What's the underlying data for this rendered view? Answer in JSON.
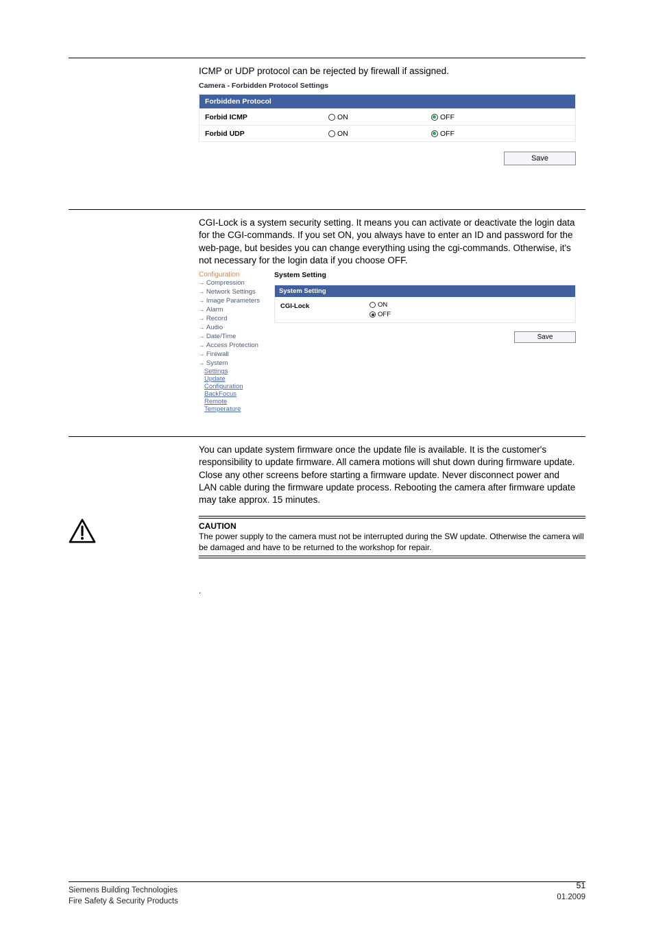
{
  "section1": {
    "intro": "ICMP or UDP protocol can be rejected by firewall if assigned.",
    "caption": "Camera - Forbidden Protocol Settings",
    "panel_title": "Forbidden Protocol",
    "rows": [
      {
        "label": "Forbid ICMP",
        "on": "ON",
        "off": "OFF"
      },
      {
        "label": "Forbid UDP",
        "on": "ON",
        "off": "OFF"
      }
    ],
    "save": "Save"
  },
  "section2": {
    "body": "CGI-Lock is a system security setting. It means you can activate or deactivate the login data for the CGI-commands. If you set ON, you always have to enter an ID and password for the web-page, but besides you can change everything using the cgi-commands. Otherwise, it's not necessary for the login data if you choose OFF.",
    "sidenav": {
      "title": "Configuration",
      "items": [
        "Compression",
        "Network Settings",
        "Image Parameters",
        "Alarm",
        "Record",
        "Audio",
        "Date/Time",
        "Access Protection",
        "Firewall",
        "System"
      ],
      "subitems": [
        "Settings",
        "Update",
        "Configuration",
        "BackFocus",
        "Remote",
        "Temperature"
      ]
    },
    "mainpane": {
      "title": "System Setting",
      "panel_title": "System Setting",
      "row_label": "CGI-Lock",
      "on": "ON",
      "off": "OFF",
      "save": "Save"
    }
  },
  "section3": {
    "body": "You can update system firmware once the update file is available. It is the customer's responsibility to update firmware. All camera motions will shut down during firmware update. Close any other screens before starting a firmware update. Never disconnect power and LAN cable during the firmware update process. Rebooting the camera after firmware update may take approx. 15 minutes.",
    "caution_title": "CAUTION",
    "caution_body": "The power supply to the camera must not be interrupted during the SW update. Otherwise the camera will be damaged and have to be returned to the workshop for repair."
  },
  "dot": ".",
  "footer": {
    "line1": "Siemens Building Technologies",
    "line2": "Fire Safety & Security Products",
    "date": "01.2009",
    "page": "51"
  }
}
